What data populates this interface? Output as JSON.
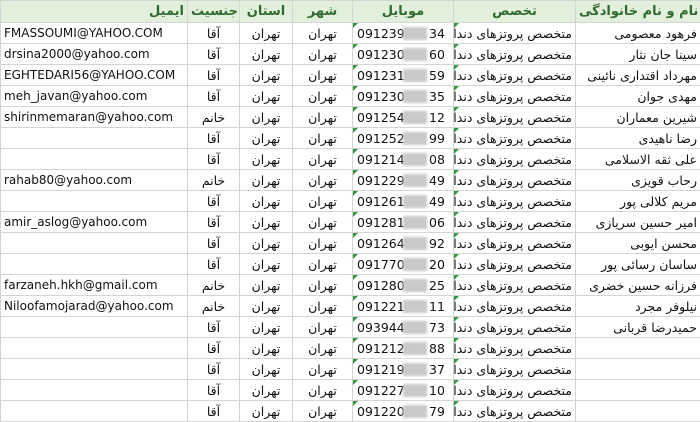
{
  "headers": {
    "email": "ایمیل",
    "gender": "جنسیت",
    "province": "استان",
    "city": "شهر",
    "mobile": "موبایل",
    "specialty": "تخصص",
    "name": "نام و نام خانوادگی"
  },
  "rows": [
    {
      "email": "FMASSOUMI@YAHOO.COM",
      "gender": "آقا",
      "province": "تهران",
      "city": "تهران",
      "mobile_prefix": "0912394",
      "mobile_suffix": "34",
      "specialty": "متخصص پروتزهای دندانی",
      "name": "فرهود معصومی"
    },
    {
      "email": "drsina2000@yahoo.com",
      "gender": "آقا",
      "province": "تهران",
      "city": "تهران",
      "mobile_prefix": "0912301",
      "mobile_suffix": "60",
      "specialty": "متخصص پروتزهای دندانی",
      "name": "سینا جان نثار"
    },
    {
      "email": "EGHTEDARI56@YAHOO.COM",
      "gender": "آقا",
      "province": "تهران",
      "city": "تهران",
      "mobile_prefix": "0912315",
      "mobile_suffix": "59",
      "specialty": "متخصص پروتزهای دندانی",
      "name": "مهرداد اقتداری نائینی"
    },
    {
      "email": "meh_javan@yahoo.com",
      "gender": "آقا",
      "province": "تهران",
      "city": "تهران",
      "mobile_prefix": "0912303",
      "mobile_suffix": "35",
      "specialty": "متخصص پروتزهای دندانی",
      "name": "مهدی جوان"
    },
    {
      "email": "shirinmemaran@yahoo.com",
      "gender": "خانم",
      "province": "تهران",
      "city": "تهران",
      "mobile_prefix": "0912549",
      "mobile_suffix": "12",
      "specialty": "متخصص پروتزهای دندانی",
      "name": "شیرین معماران"
    },
    {
      "email": "",
      "gender": "آقا",
      "province": "تهران",
      "city": "تهران",
      "mobile_prefix": "0912526",
      "mobile_suffix": "99",
      "specialty": "متخصص پروتزهای دندانی",
      "name": "رضا ناهیدی"
    },
    {
      "email": "",
      "gender": "آقا",
      "province": "تهران",
      "city": "تهران",
      "mobile_prefix": "0912143",
      "mobile_suffix": "08",
      "specialty": "متخصص پروتزهای دندانی",
      "name": "علی ثقه الاسلامی"
    },
    {
      "email": "rahab80@yahoo.com",
      "gender": "خانم",
      "province": "تهران",
      "city": "تهران",
      "mobile_prefix": "0912290",
      "mobile_suffix": "49",
      "specialty": "متخصص پروتزهای دندانی",
      "name": "رحاب قویزی"
    },
    {
      "email": "",
      "gender": "آقا",
      "province": "تهران",
      "city": "تهران",
      "mobile_prefix": "0912618",
      "mobile_suffix": "49",
      "specialty": "متخصص پروتزهای دندانی",
      "name": "مریم کلالی پور"
    },
    {
      "email": "amir_aslog@yahoo.com",
      "gender": "آقا",
      "province": "تهران",
      "city": "تهران",
      "mobile_prefix": "0912812",
      "mobile_suffix": "06",
      "specialty": "متخصص پروتزهای دندانی",
      "name": "امیر حسین سریازی"
    },
    {
      "email": "",
      "gender": "آقا",
      "province": "تهران",
      "city": "تهران",
      "mobile_prefix": "0912649",
      "mobile_suffix": "92",
      "specialty": "متخصص پروتزهای دندانی",
      "name": "محسن ایوبی"
    },
    {
      "email": "",
      "gender": "آقا",
      "province": "تهران",
      "city": "تهران",
      "mobile_prefix": "0917700",
      "mobile_suffix": "20",
      "specialty": "متخصص پروتزهای دندانی",
      "name": "ساسان رسائی پور"
    },
    {
      "email": "farzaneh.hkh@gmail.com",
      "gender": "خانم",
      "province": "تهران",
      "city": "تهران",
      "mobile_prefix": "0912803",
      "mobile_suffix": "25",
      "specialty": "متخصص پروتزهای دندانی",
      "name": "فرزانه حسین خضری"
    },
    {
      "email": "Niloofamojarad@yahoo.com",
      "gender": "خانم",
      "province": "تهران",
      "city": "تهران",
      "mobile_prefix": "0912211",
      "mobile_suffix": "11",
      "specialty": "متخصص پروتزهای دندانی",
      "name": "نیلوفر مجرد"
    },
    {
      "email": "",
      "gender": "آقا",
      "province": "تهران",
      "city": "تهران",
      "mobile_prefix": "0939445",
      "mobile_suffix": "73",
      "specialty": "متخصص پروتزهای دندانی",
      "name": "حمیدرضا قربانی"
    },
    {
      "email": "",
      "gender": "آقا",
      "province": "تهران",
      "city": "تهران",
      "mobile_prefix": "0912127",
      "mobile_suffix": "88",
      "specialty": "متخصص پروتزهای دندانی (ثابه رحمت اله امیرلو",
      "name": ""
    },
    {
      "email": "",
      "gender": "آقا",
      "province": "تهران",
      "city": "تهران",
      "mobile_prefix": "0912193",
      "mobile_suffix": "37",
      "specialty": "متخصص پروتزهای دندانی (ثابه رضا پروهان",
      "name": ""
    },
    {
      "email": "",
      "gender": "آقا",
      "province": "تهران",
      "city": "تهران",
      "mobile_prefix": "0912270",
      "mobile_suffix": "10",
      "specialty": "متخصص پروتزهای دندانی (ثابه جعفر دادمنش",
      "name": ""
    },
    {
      "email": "",
      "gender": "آقا",
      "province": "تهران",
      "city": "تهران",
      "mobile_prefix": "0912204",
      "mobile_suffix": "79",
      "specialty": "متخصص پروتزهای دندانی (ثابه محمد امامیه",
      "name": ""
    }
  ]
}
